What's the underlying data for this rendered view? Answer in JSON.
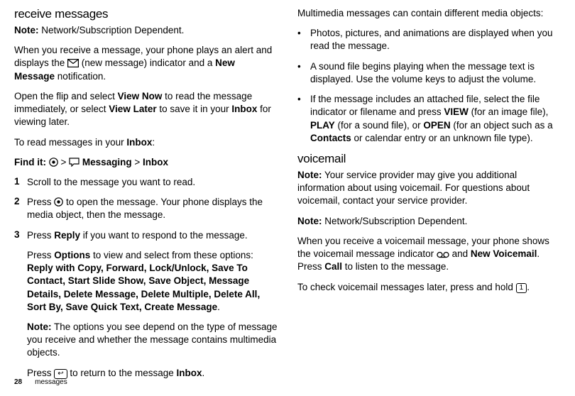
{
  "left": {
    "heading": "receive messages",
    "note1_label": "Note:",
    "note1_text": " Network/Subscription Dependent.",
    "p2a": "When you receive a message, your phone plays an alert and displays the ",
    "p2b": " (new message) indicator and a ",
    "p2c": "New Message",
    "p2d": " notification.",
    "p3a": "Open the flip and select ",
    "p3b": "View Now",
    "p3c": " to read the message immediately, or select ",
    "p3d": "View Later",
    "p3e": " to save it in your ",
    "p3f": "Inbox",
    "p3g": " for viewing later.",
    "p4a": "To read messages in your ",
    "p4b": "Inbox",
    "p4c": ":",
    "find_label": "Find it: ",
    "find_sep1": " > ",
    "find_msg": " Messaging",
    "find_sep2": " > ",
    "find_inbox": "Inbox",
    "step1": "Scroll to the message you want to read.",
    "step2a": "Press ",
    "step2b": " to open the message. Your phone displays the media object, then the message.",
    "step3a": "Press ",
    "step3b": "Reply",
    "step3c": " if you want to respond to the message.",
    "opt_a": "Press ",
    "opt_b": "Options",
    "opt_c": " to view and select from these options: ",
    "opts": "Reply with Copy, Forward, Lock/Unlock, Save To Contact, Start Slide Show, Save Object, Message Details, Delete Message, Delete Multiple, Delete All, Sort By, Save Quick Text, Create Message",
    "opt_end": ".",
    "note2_label": "Note:",
    "note2_text": " The options you see depend on the type of message you receive and whether the message contains multimedia objects.",
    "ret_a": "Press ",
    "ret_b": " to return to the message ",
    "ret_c": "Inbox",
    "ret_d": "."
  },
  "right": {
    "p1": "Multimedia messages can contain different media objects:",
    "b1": "Photos, pictures, and animations are displayed when you read the message.",
    "b2": "A sound file begins playing when the message text is displayed. Use the volume keys to adjust the volume.",
    "b3a": "If the message includes an attached file, select the file indicator or filename and press ",
    "b3b": "VIEW",
    "b3c": " (for an image file), ",
    "b3d": "PLAY",
    "b3e": " (for a sound file), or ",
    "b3f": "OPEN",
    "b3g": " (for an object such as a ",
    "b3h": "Contacts",
    "b3i": " or calendar entry or an unknown file type).",
    "heading2": "voicemail",
    "vnote1_label": "Note:",
    "vnote1_text": " Your service provider may give you additional information about using voicemail. For questions about voicemail, contact your service provider.",
    "vnote2_label": "Note:",
    "vnote2_text": " Network/Subscription Dependent.",
    "vp_a": "When you receive a voicemail message, your phone shows the voicemail message indicator ",
    "vp_b": " and ",
    "vp_c": "New Voicemail",
    "vp_d": ". Press ",
    "vp_e": "Call",
    "vp_f": " to listen to the message.",
    "vp2a": "To check voicemail messages later, press and hold ",
    "vp2b": "1",
    "vp2c": "."
  },
  "footer": {
    "page": "28",
    "section": "messages"
  },
  "glyph": {
    "back": "↩"
  }
}
